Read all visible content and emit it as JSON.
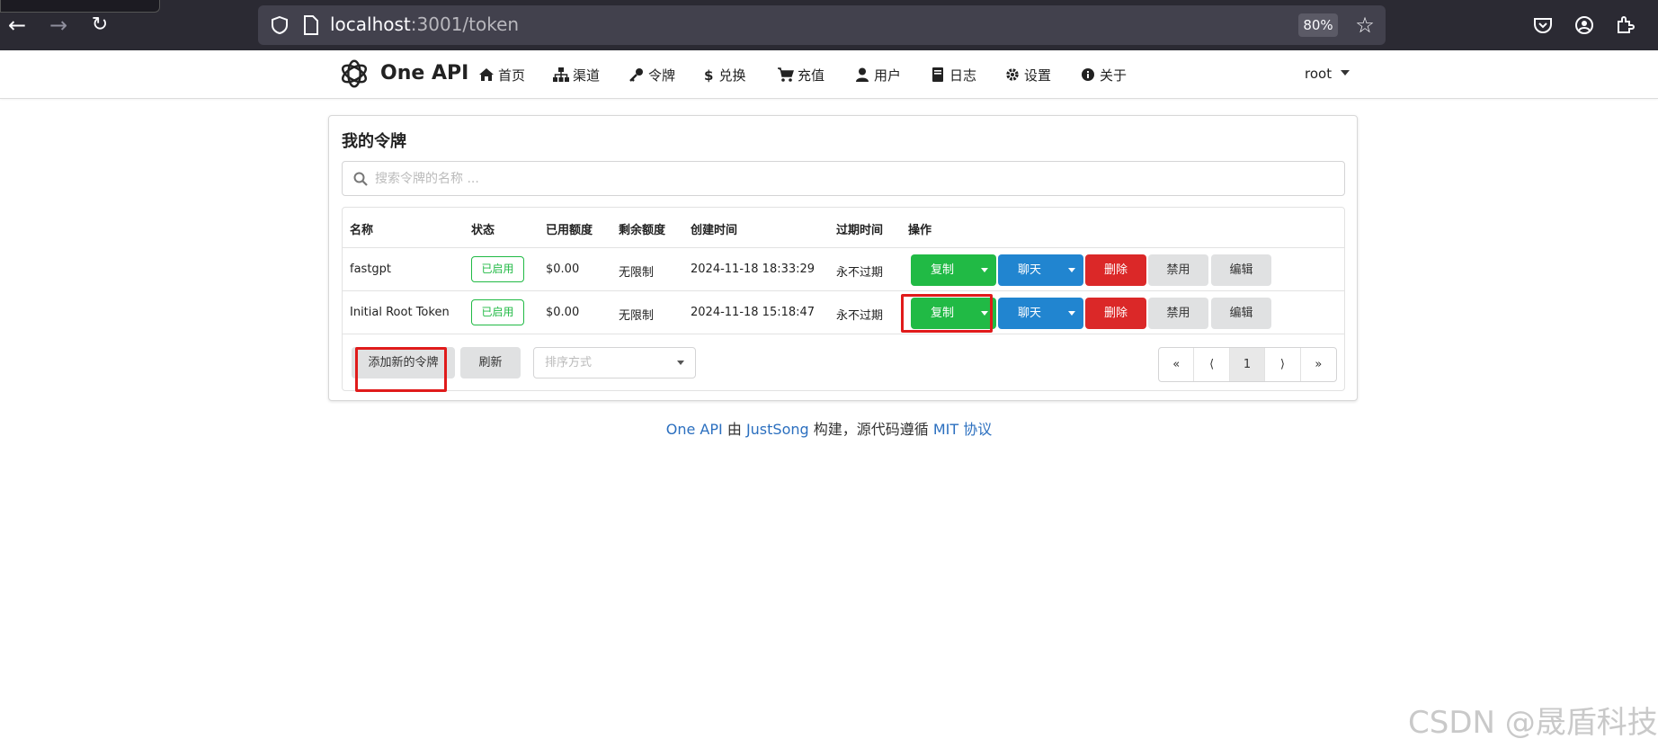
{
  "browser": {
    "url_host": "localhost",
    "url_rest": ":3001/token",
    "zoom": "80%"
  },
  "header": {
    "brand": "One API",
    "nav": [
      {
        "label": "首页",
        "icon": "home-icon"
      },
      {
        "label": "渠道",
        "icon": "sitemap-icon"
      },
      {
        "label": "令牌",
        "icon": "key-icon"
      },
      {
        "label": "兑换",
        "icon": "dollar-icon"
      },
      {
        "label": "充值",
        "icon": "cart-icon"
      },
      {
        "label": "用户",
        "icon": "user-icon"
      },
      {
        "label": "日志",
        "icon": "book-icon"
      },
      {
        "label": "设置",
        "icon": "gear-icon"
      },
      {
        "label": "关于",
        "icon": "info-icon"
      }
    ],
    "user": "root"
  },
  "card": {
    "title": "我的令牌",
    "search_placeholder": "搜索令牌的名称 ..."
  },
  "table": {
    "columns": [
      "名称",
      "状态",
      "已用额度",
      "剩余额度",
      "创建时间",
      "过期时间",
      "操作"
    ],
    "rows": [
      {
        "name": "fastgpt",
        "status": "已启用",
        "used": "$0.00",
        "remaining": "无限制",
        "created": "2024-11-18 18:33:29",
        "expires": "永不过期"
      },
      {
        "name": "Initial Root Token",
        "status": "已启用",
        "used": "$0.00",
        "remaining": "无限制",
        "created": "2024-11-18 15:18:47",
        "expires": "永不过期"
      }
    ],
    "actions": {
      "copy": "复制",
      "chat": "聊天",
      "delete": "删除",
      "disable": "禁用",
      "edit": "编辑"
    }
  },
  "toolbar": {
    "add": "添加新的令牌",
    "refresh": "刷新",
    "sort_placeholder": "排序方式"
  },
  "pagination": {
    "first": "«",
    "prev": "⟨",
    "page": "1",
    "next": "⟩",
    "last": "»"
  },
  "footer": {
    "p1": "One API",
    "p2": " 由 ",
    "p3": "JustSong",
    "p4": " 构建，源代码遵循 ",
    "p5": "MIT 协议"
  },
  "watermark": "CSDN @晟盾科技",
  "colors": {
    "green": "#21ba45",
    "blue": "#2185d0",
    "red": "#db2828",
    "highlight": "#e01b1b"
  }
}
